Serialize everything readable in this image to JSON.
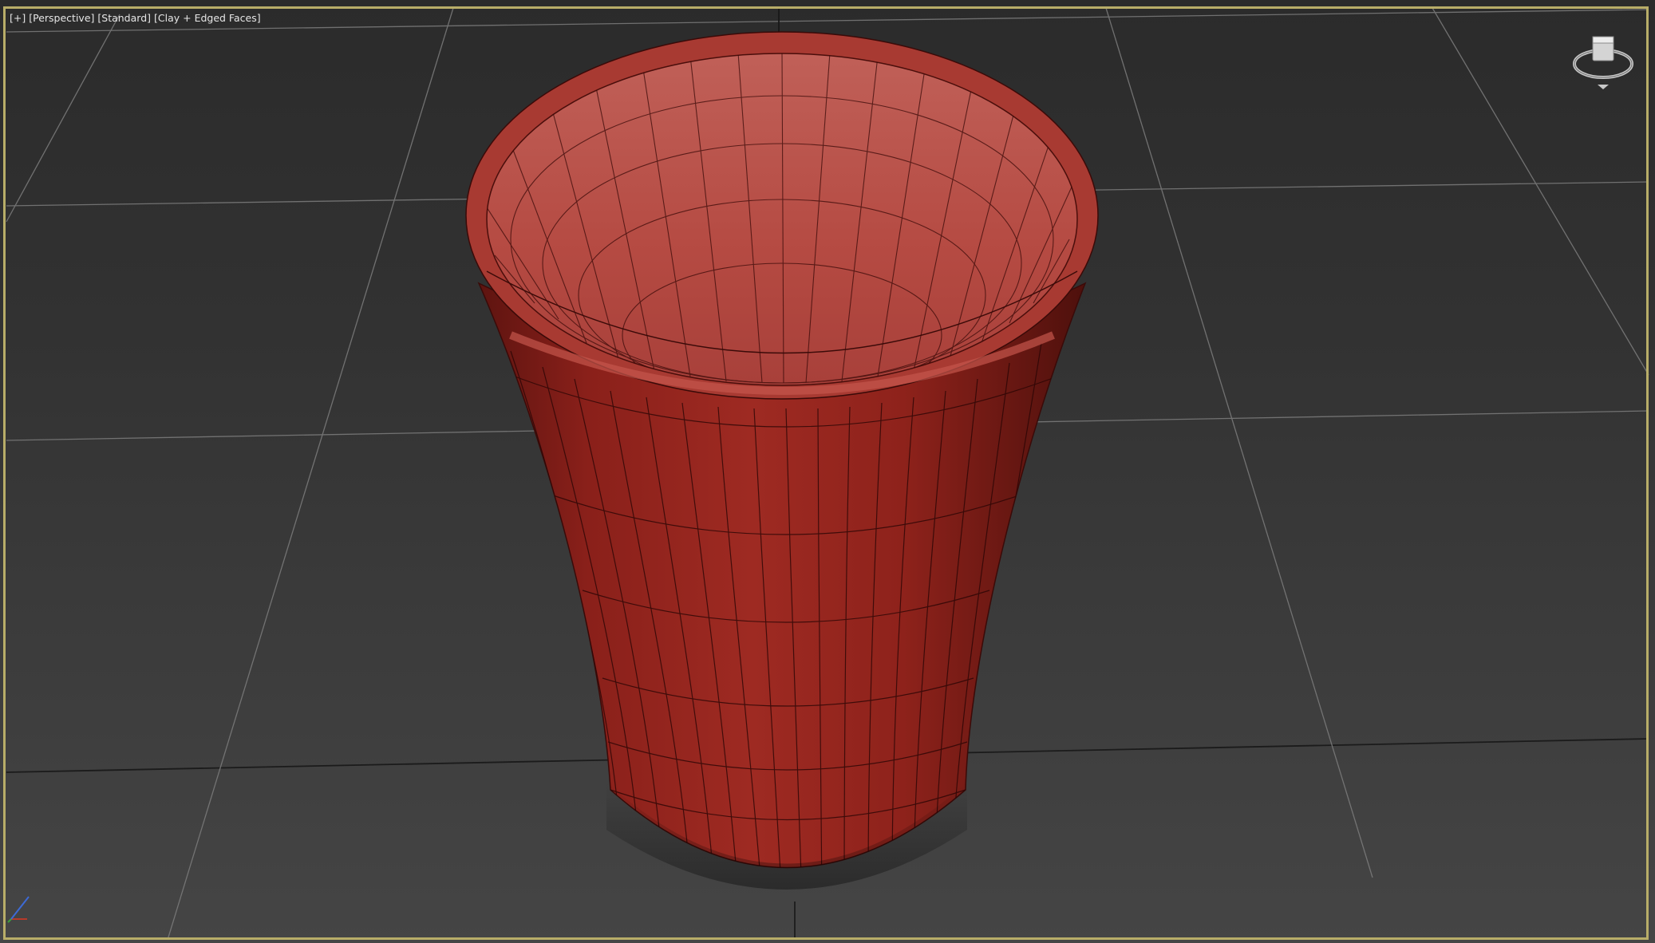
{
  "viewport": {
    "menu_label": "[+]",
    "view_label": "[Perspective]",
    "shading_style_label": "[Standard]",
    "display_mode_label": "[Clay + Edged Faces]"
  },
  "colors": {
    "frame_border": "#b8ad68",
    "mesh_color": "#9e2a22",
    "grid_line": "#7a7a7a",
    "background_top": "#2b2b2b",
    "background_bottom": "#454545"
  },
  "widgets": {
    "viewcube_icon": "viewcube-icon",
    "axis_icon": "axis-tripod-icon"
  }
}
